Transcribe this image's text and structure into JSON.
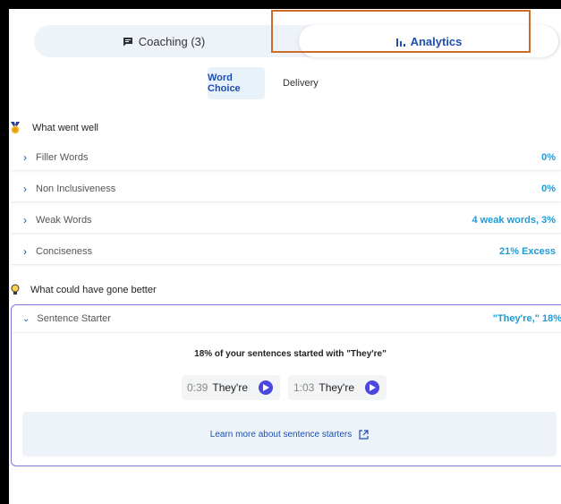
{
  "toggle": {
    "coaching_label": "Coaching (3)",
    "analytics_label": "Analytics",
    "coaching_icon": "chat-bubble-icon",
    "analytics_icon": "bar-chart-icon"
  },
  "subtabs": {
    "word_choice": "Word Choice",
    "delivery": "Delivery"
  },
  "went_well": {
    "title": "What went well",
    "icon": "medal-icon",
    "rows": [
      {
        "label": "Filler Words",
        "value": "0%"
      },
      {
        "label": "Non Inclusiveness",
        "value": "0%"
      },
      {
        "label": "Weak Words",
        "value": "4 weak words, 3%"
      },
      {
        "label": "Conciseness",
        "value": "21% Excess"
      }
    ]
  },
  "better": {
    "title": "What could have gone better",
    "icon": "lightbulb-icon",
    "card": {
      "label": "Sentence Starter",
      "value": "\"They're,\" 18%",
      "summary": "18% of your sentences started with \"They're\"",
      "chips": [
        {
          "time": "0:39",
          "word": "They're"
        },
        {
          "time": "1:03",
          "word": "They're"
        }
      ],
      "learn_more": "Learn more about sentence starters"
    }
  },
  "colors": {
    "accent": "#1c4fb0",
    "value": "#1d9bd9",
    "highlight": "#cd6b28",
    "play": "#4b47e0",
    "card_border": "#7d7ad6"
  }
}
